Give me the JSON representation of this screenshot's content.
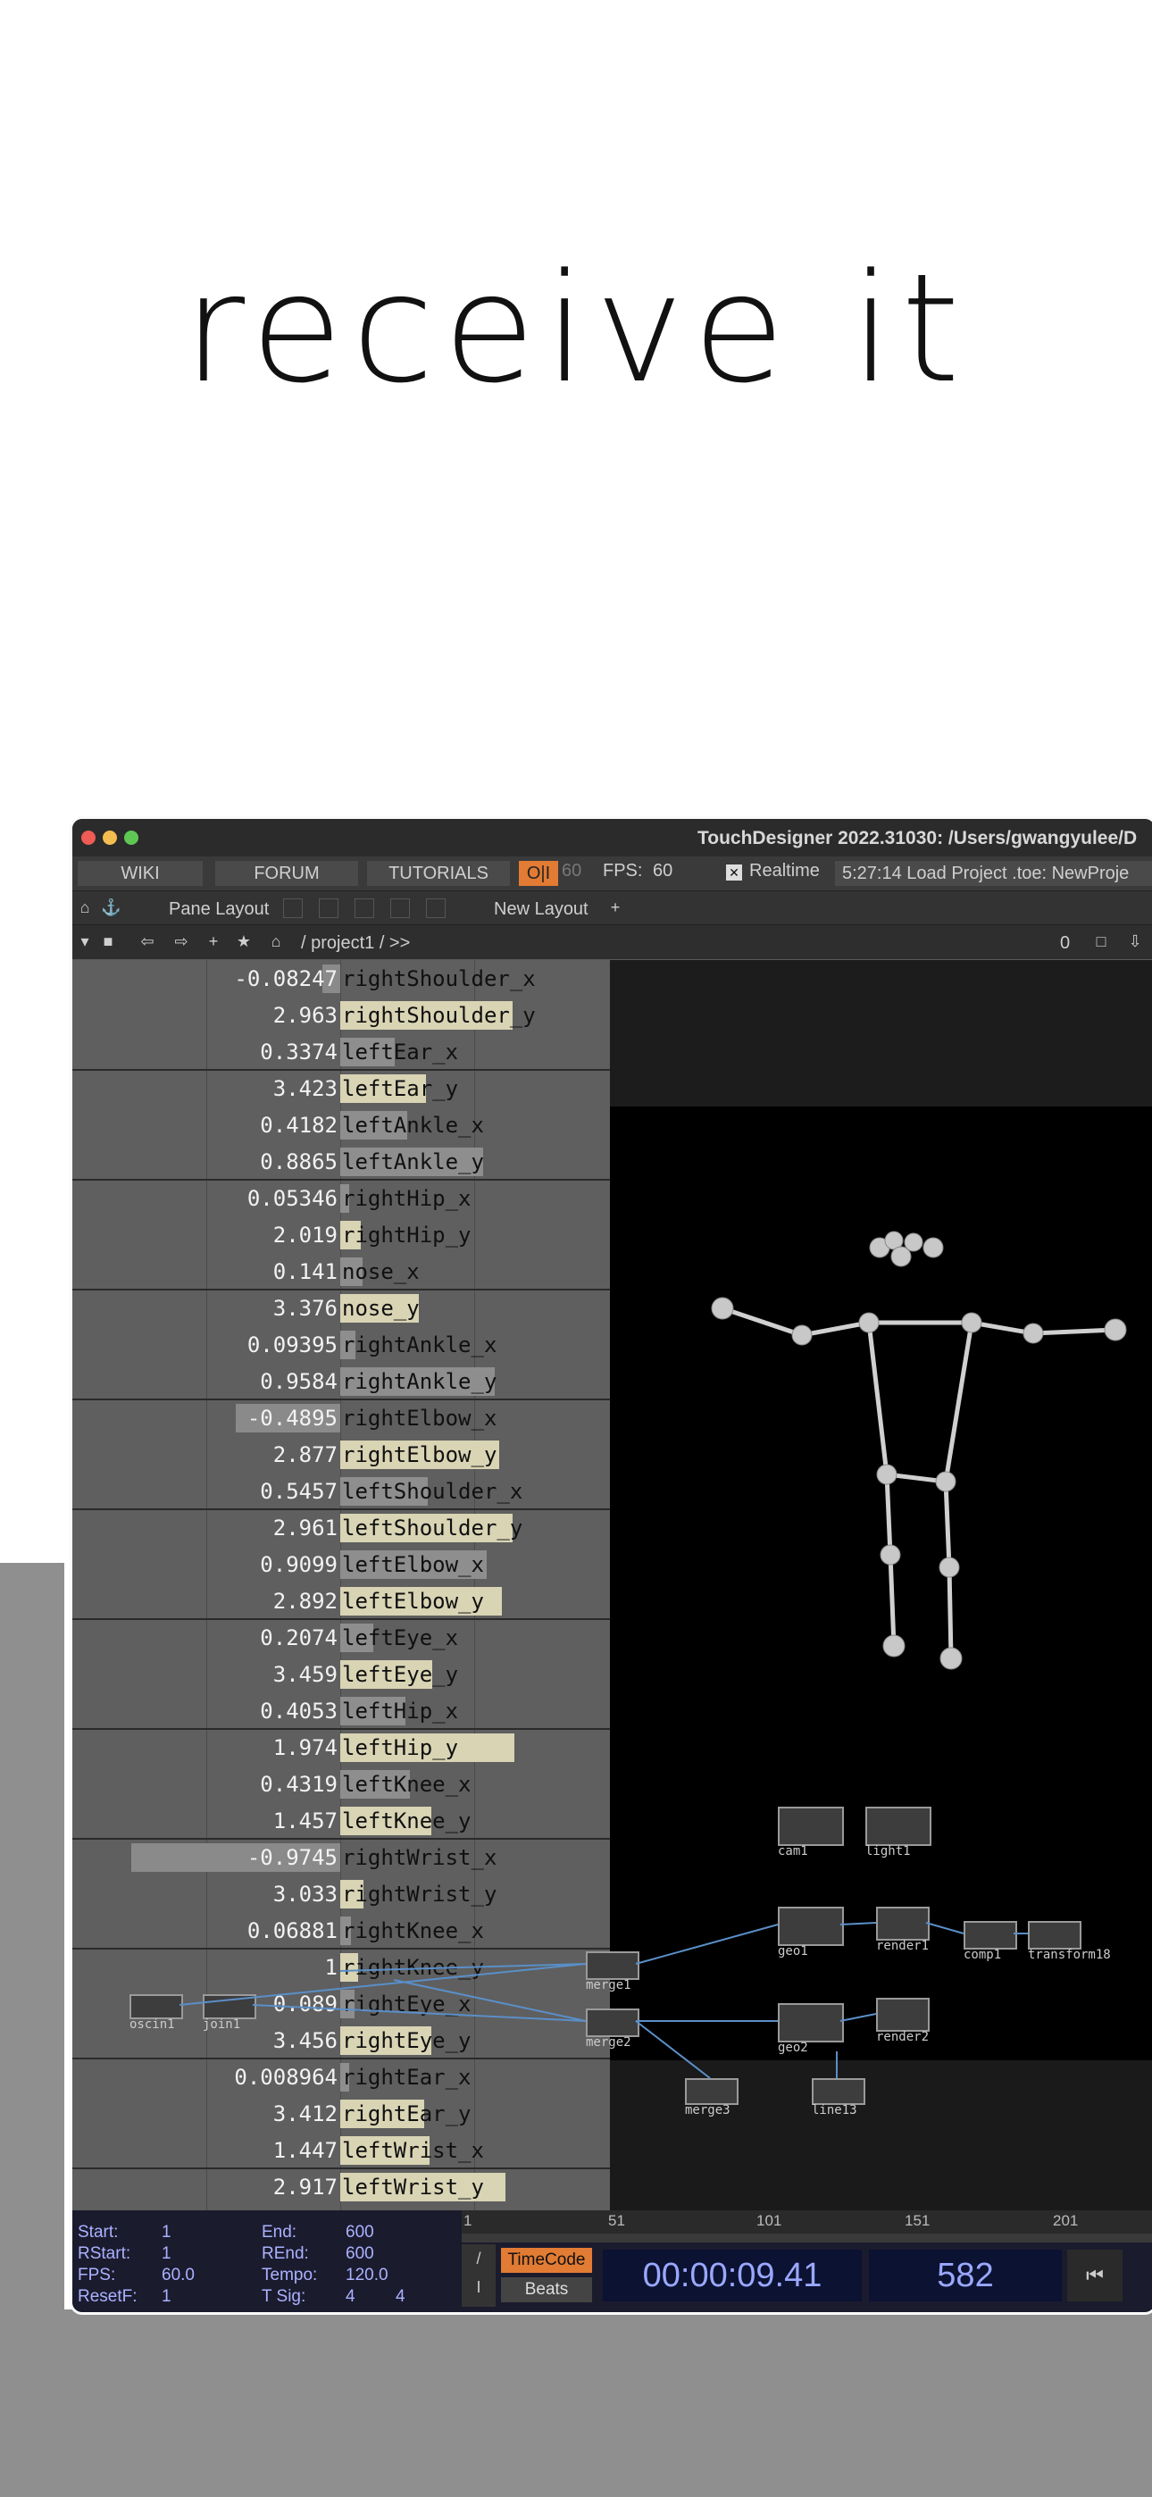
{
  "hero": {
    "title": "receive it"
  },
  "window": {
    "title": "TouchDesigner 2022.31030: /Users/gwangyulee/D",
    "menu": [
      "WIKI",
      "FORUM",
      "TUTORIALS"
    ],
    "oi_label": "O|I",
    "fps_target": "60",
    "fps_label": "FPS:",
    "fps_value": "60",
    "realtime_label": "Realtime",
    "status": "5:27:14 Load Project .toe: NewProje",
    "pane_layout": "Pane Layout",
    "new_layout": "New Layout",
    "path": "/ project1 / >>",
    "path_counter": "0"
  },
  "channels": [
    {
      "value": "-0.08247",
      "name": "rightShoulder_x"
    },
    {
      "value": "2.963",
      "name": "rightShoulder_y"
    },
    {
      "value": "0.3374",
      "name": "leftEar_x"
    },
    {
      "value": "3.423",
      "name": "leftEar_y"
    },
    {
      "value": "0.4182",
      "name": "leftAnkle_x"
    },
    {
      "value": "0.8865",
      "name": "leftAnkle_y"
    },
    {
      "value": "0.05346",
      "name": "rightHip_x"
    },
    {
      "value": "2.019",
      "name": "rightHip_y"
    },
    {
      "value": "0.141",
      "name": "nose_x"
    },
    {
      "value": "3.376",
      "name": "nose_y"
    },
    {
      "value": "0.09395",
      "name": "rightAnkle_x"
    },
    {
      "value": "0.9584",
      "name": "rightAnkle_y"
    },
    {
      "value": "-0.4895",
      "name": "rightElbow_x"
    },
    {
      "value": "2.877",
      "name": "rightElbow_y"
    },
    {
      "value": "0.5457",
      "name": "leftShoulder_x"
    },
    {
      "value": "2.961",
      "name": "leftShoulder_y"
    },
    {
      "value": "0.9099",
      "name": "leftElbow_x"
    },
    {
      "value": "2.892",
      "name": "leftElbow_y"
    },
    {
      "value": "0.2074",
      "name": "leftEye_x"
    },
    {
      "value": "3.459",
      "name": "leftEye_y"
    },
    {
      "value": "0.4053",
      "name": "leftHip_x"
    },
    {
      "value": "1.974",
      "name": "leftHip_y"
    },
    {
      "value": "0.4319",
      "name": "leftKnee_x"
    },
    {
      "value": "1.457",
      "name": "leftKnee_y"
    },
    {
      "value": "-0.9745",
      "name": "rightWrist_x"
    },
    {
      "value": "3.033",
      "name": "rightWrist_y"
    },
    {
      "value": "0.06881",
      "name": "rightKnee_x"
    },
    {
      "value": "1",
      "name": "rightKnee_y"
    },
    {
      "value": "0.089",
      "name": "rightEye_x"
    },
    {
      "value": "3.456",
      "name": "rightEye_y"
    },
    {
      "value": "0.008964",
      "name": "rightEar_x"
    },
    {
      "value": "3.412",
      "name": "rightEar_y"
    },
    {
      "value": "1.447",
      "name": "leftWrist_x"
    },
    {
      "value": "2.917",
      "name": "leftWrist_y"
    }
  ],
  "nodes": [
    {
      "label": "cam1"
    },
    {
      "label": "light1"
    },
    {
      "label": "geo1"
    },
    {
      "label": "render1"
    },
    {
      "label": "comp1"
    },
    {
      "label": "transform18"
    },
    {
      "label": "geo2"
    },
    {
      "label": "render2"
    },
    {
      "label": "merge1"
    },
    {
      "label": "merge2"
    },
    {
      "label": "merge3"
    },
    {
      "label": "line13"
    },
    {
      "label": "oscin1"
    },
    {
      "label": "join1"
    }
  ],
  "timeline": {
    "start_label": "Start:",
    "start": "1",
    "end_label": "End:",
    "end": "600",
    "rstart_label": "RStart:",
    "rstart": "1",
    "rend_label": "REnd:",
    "rend": "600",
    "fps_label": "FPS:",
    "fps": "60.0",
    "tempo_label": "Tempo:",
    "tempo": "120.0",
    "resetf_label": "ResetF:",
    "resetf": "1",
    "tsig_label": "T Sig:",
    "tsig_a": "4",
    "tsig_b": "4",
    "ticks": [
      "1",
      "51",
      "101",
      "151",
      "201"
    ],
    "timecode_label": "TimeCode",
    "beats_label": "Beats",
    "time": "00:00:09.41",
    "frame": "582"
  },
  "colors": {
    "accent": "#e27b33",
    "highlight": "#d8d4b4",
    "display_text": "#9aa8ff"
  }
}
